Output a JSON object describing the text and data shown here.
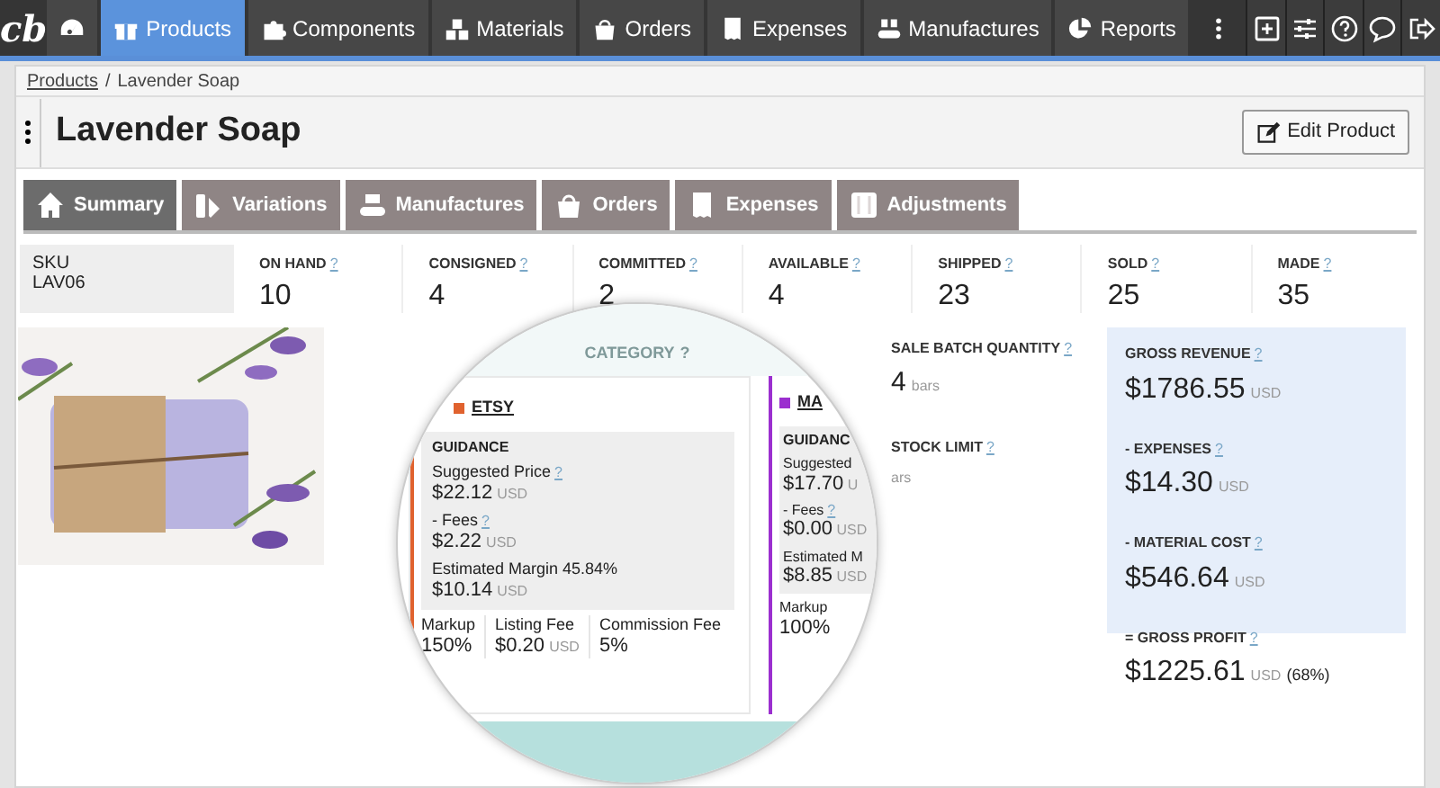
{
  "nav": {
    "logo": "cb",
    "items": [
      {
        "selected": false
      },
      {
        "label": "Products",
        "selected": true
      },
      {
        "label": "Components",
        "selected": false
      },
      {
        "label": "Materials",
        "selected": false
      },
      {
        "label": "Orders",
        "selected": false
      },
      {
        "label": "Expenses",
        "selected": false
      },
      {
        "label": "Manufactures",
        "selected": false
      },
      {
        "label": "Reports",
        "selected": false
      }
    ]
  },
  "breadcrumb": {
    "separator": "/",
    "items": [
      {
        "label": "Products",
        "link": true
      },
      {
        "label": "Lavender Soap",
        "link": false
      }
    ]
  },
  "page": {
    "title": "Lavender Soap",
    "edit_button": "Edit Product"
  },
  "tabs": [
    {
      "label": "Summary",
      "selected": true
    },
    {
      "label": "Variations",
      "selected": false
    },
    {
      "label": "Manufactures",
      "selected": false
    },
    {
      "label": "Orders",
      "selected": false
    },
    {
      "label": "Expenses",
      "selected": false
    },
    {
      "label": "Adjustments",
      "selected": false
    }
  ],
  "sku": {
    "label": "SKU",
    "value": "LAV06"
  },
  "stats": [
    {
      "label": "ON HAND",
      "help": "?",
      "value": "10"
    },
    {
      "label": "CONSIGNED",
      "help": "?",
      "value": "4"
    },
    {
      "label": "COMMITTED",
      "help": "?",
      "value": "2"
    },
    {
      "label": "AVAILABLE",
      "help": "?",
      "value": "4"
    },
    {
      "label": "SHIPPED",
      "help": "?",
      "value": "23"
    },
    {
      "label": "SOLD",
      "help": "?",
      "value": "25"
    },
    {
      "label": "MADE",
      "help": "?",
      "value": "35"
    }
  ],
  "magnifier": {
    "category_label": "CATEGORY",
    "category_help": "?",
    "channels": [
      {
        "name": "ETSY",
        "color": "#e0622e",
        "guidance": "GUIDANCE",
        "suggested_label": "Suggested Price",
        "suggested_help": "?",
        "suggested_value": "$22.12",
        "suggested_unit": "USD",
        "fees_label": "- Fees",
        "fees_help": "?",
        "fees_value": "$2.22",
        "fees_unit": "USD",
        "margin_label": "Estimated Margin 45.84%",
        "margin_value": "$10.14",
        "margin_unit": "USD",
        "details": [
          {
            "label": "Markup",
            "value": "150%"
          },
          {
            "label": "Listing Fee",
            "value": "$0.20",
            "unit": "USD"
          },
          {
            "label": "Commission Fee",
            "value": "5%"
          }
        ]
      },
      {
        "name": "MA",
        "color": "#9b2fcf",
        "guidance": "GUIDANC",
        "suggested_label": "Suggested",
        "suggested_value": "$17.70",
        "suggested_unit": "U",
        "fees_label": "- Fees",
        "fees_help": "?",
        "fees_value": "$0.00",
        "fees_unit": "USD",
        "margin_label": "Estimated M",
        "margin_value": "$8.85",
        "margin_unit": "USD",
        "details": [
          {
            "label": "Markup",
            "value": "100%"
          }
        ]
      }
    ]
  },
  "batch": {
    "label": "SALE BATCH QUANTITY",
    "help": "?",
    "value": "4",
    "unit": "bars"
  },
  "stock": {
    "label": "STOCK LIMIT",
    "help": "?",
    "unit": "ars"
  },
  "financials": [
    {
      "label": "GROSS REVENUE",
      "help": "?",
      "value": "$1786.55",
      "unit": "USD"
    },
    {
      "label": "- EXPENSES",
      "help": "?",
      "value": "$14.30",
      "unit": "USD"
    },
    {
      "label": "- MATERIAL COST",
      "help": "?",
      "value": "$546.64",
      "unit": "USD"
    },
    {
      "label": "= GROSS PROFIT",
      "help": "?",
      "value": "$1225.61",
      "unit": "USD",
      "note": "(68%)"
    }
  ]
}
